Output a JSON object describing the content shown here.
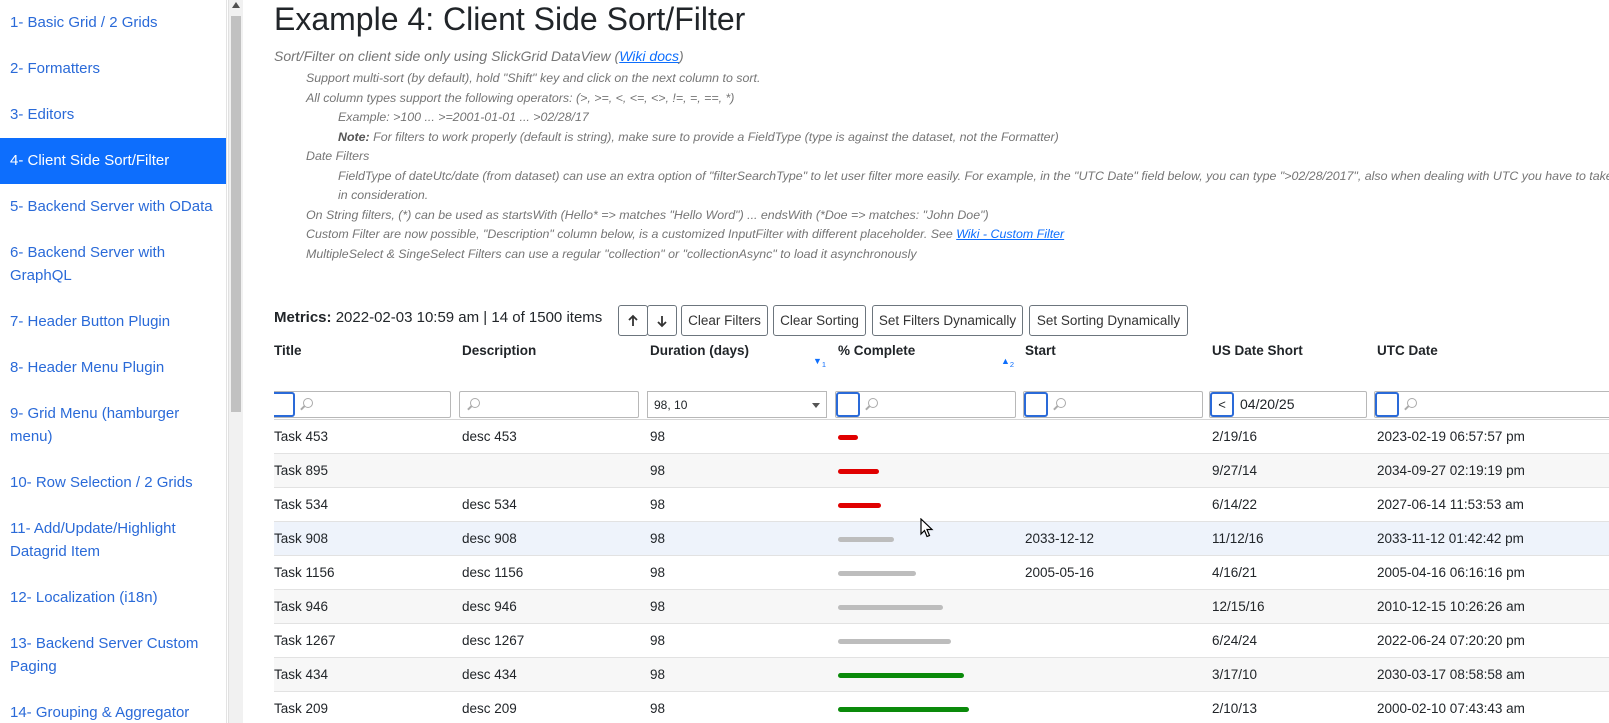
{
  "sidebar": {
    "items": [
      {
        "label": "1- Basic Grid / 2 Grids"
      },
      {
        "label": "2- Formatters"
      },
      {
        "label": "3- Editors"
      },
      {
        "label": "4- Client Side Sort/Filter"
      },
      {
        "label": "5- Backend Server with OData"
      },
      {
        "label": "6- Backend Server with GraphQL"
      },
      {
        "label": "7- Header Button Plugin"
      },
      {
        "label": "8- Header Menu Plugin"
      },
      {
        "label": "9- Grid Menu (hamburger menu)"
      },
      {
        "label": "10- Row Selection / 2 Grids"
      },
      {
        "label": "11- Add/Update/Highlight Datagrid Item"
      },
      {
        "label": "12- Localization (i18n)"
      },
      {
        "label": "13- Backend Server Custom Paging"
      },
      {
        "label": "14- Grouping & Aggregator"
      }
    ],
    "active_index": 3
  },
  "page": {
    "title": "Example 4: Client Side Sort/Filter",
    "subtitle_text": "Sort/Filter on client side only using SlickGrid DataView (",
    "subtitle_link": "Wiki docs",
    "subtitle_end": ")",
    "notes": [
      "Support multi-sort (by default), hold \"Shift\" key and click on the next column to sort.",
      "All column types support the following operators: (>, >=, <, <=, <>, !=, =, ==, *)",
      "Example: >100 ... >=2001-01-01 ... >02/28/17",
      "For filters to work properly (default is string), make sure to provide a FieldType (type is against the dataset, not the Formatter)",
      "Date Filters",
      "FieldType of dateUtc/date (from dataset) can use an extra option of \"filterSearchType\" to let user filter more easily. For example, in the \"UTC Date\" field below, you can type \">02/28/2017\", also when dealing with UTC you have to take the time difference",
      "in consideration.",
      "On String filters, (*) can be used as startsWith (Hello* => matches \"Hello Word\") ... endsWith (*Doe => matches: \"John Doe\")",
      "Custom Filter are now possible, \"Description\" column below, is a customized InputFilter with different placeholder. See ",
      "MultipleSelect & SingeSelect Filters can use a regular \"collection\" or \"collectionAsync\" to load it asynchronously"
    ],
    "note_label": "Note:",
    "custom_filter_link": "Wiki - Custom Filter"
  },
  "toolbar": {
    "metrics_label": "Metrics:",
    "metrics_value": "2022-02-03 10:59 am | 14 of 1500 items",
    "clear_filters": "Clear Filters",
    "clear_sorting": "Clear Sorting",
    "set_filters": "Set Filters Dynamically",
    "set_sorting": "Set Sorting Dynamically"
  },
  "grid": {
    "columns": [
      "Title",
      "Description",
      "Duration (days)",
      "% Complete",
      "Start",
      "US Date Short",
      "UTC Date"
    ],
    "sort_indicators": [
      {
        "column": "Duration (days)",
        "direction": "desc",
        "order": "1"
      },
      {
        "column": "% Complete",
        "direction": "asc",
        "order": "2"
      }
    ],
    "filters": {
      "duration_selected": "98, 10",
      "us_date_operator": "<",
      "us_date_value": "04/20/25"
    },
    "rows": [
      {
        "title": "Task 453",
        "description": "desc 453",
        "duration": "98",
        "percent": 11,
        "start": "",
        "us_date": "2/19/16",
        "utc_date": "2023-02-19 06:57:57 pm"
      },
      {
        "title": "Task 895",
        "description": "",
        "duration": "98",
        "percent": 22,
        "start": "",
        "us_date": "9/27/14",
        "utc_date": "2034-09-27 02:19:19 pm"
      },
      {
        "title": "Task 534",
        "description": "desc 534",
        "duration": "98",
        "percent": 23,
        "start": "",
        "us_date": "6/14/22",
        "utc_date": "2027-06-14 11:53:53 am"
      },
      {
        "title": "Task 908",
        "description": "desc 908",
        "duration": "98",
        "percent": 30,
        "start": "2033-12-12",
        "us_date": "11/12/16",
        "utc_date": "2033-11-12 01:42:42 pm"
      },
      {
        "title": "Task 1156",
        "description": "desc 1156",
        "duration": "98",
        "percent": 42,
        "start": "2005-05-16",
        "us_date": "4/16/21",
        "utc_date": "2005-04-16 06:16:16 pm"
      },
      {
        "title": "Task 946",
        "description": "desc 946",
        "duration": "98",
        "percent": 57,
        "start": "",
        "us_date": "12/15/16",
        "utc_date": "2010-12-15 10:26:26 am"
      },
      {
        "title": "Task 1267",
        "description": "desc 1267",
        "duration": "98",
        "percent": 61,
        "start": "",
        "us_date": "6/24/24",
        "utc_date": "2022-06-24 07:20:20 pm"
      },
      {
        "title": "Task 434",
        "description": "desc 434",
        "duration": "98",
        "percent": 68,
        "start": "",
        "us_date": "3/17/10",
        "utc_date": "2030-03-17 08:58:58 am"
      },
      {
        "title": "Task 209",
        "description": "desc 209",
        "duration": "98",
        "percent": 71,
        "start": "",
        "us_date": "2/10/13",
        "utc_date": "2000-02-10 07:43:43 am"
      }
    ]
  },
  "colors": {
    "accent": "#0d6efd",
    "bar_red": "#e00000",
    "bar_grey": "#bdbdbd",
    "bar_green": "#0a8a0a"
  }
}
